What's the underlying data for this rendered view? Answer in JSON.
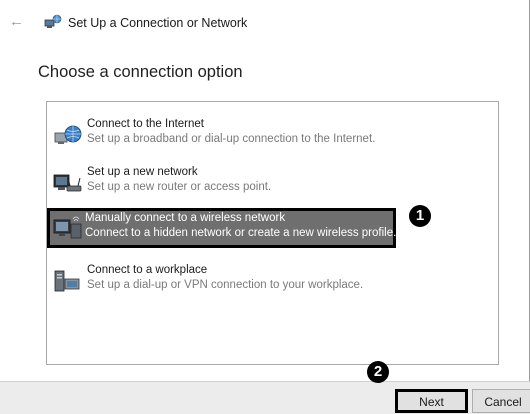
{
  "window": {
    "title": "Set Up a Connection or Network",
    "back_glyph": "←",
    "back_icon": "back-arrow-icon",
    "title_icon": "network-setup-icon"
  },
  "page": {
    "heading": "Choose a connection option"
  },
  "options": [
    {
      "title": "Connect to the Internet",
      "description": "Set up a broadband or dial-up connection to the Internet.",
      "icon": "internet-globe-icon",
      "selected": false
    },
    {
      "title": "Set up a new network",
      "description": "Set up a new router or access point.",
      "icon": "router-icon",
      "selected": false
    },
    {
      "title": "Manually connect to a wireless network",
      "description": "Connect to a hidden network or create a new wireless profile.",
      "icon": "wireless-computer-icon",
      "selected": true
    },
    {
      "title": "Connect to a workplace",
      "description": "Set up a dial-up or VPN connection to your workplace.",
      "icon": "workplace-icon",
      "selected": false
    }
  ],
  "annotations": {
    "step1": "1",
    "step2": "2"
  },
  "buttons": {
    "next": "Next",
    "cancel": "Cancel"
  },
  "colors": {
    "selected_background": "#6f6f6f",
    "highlight_border": "#000000",
    "footer_background": "#ececec"
  }
}
